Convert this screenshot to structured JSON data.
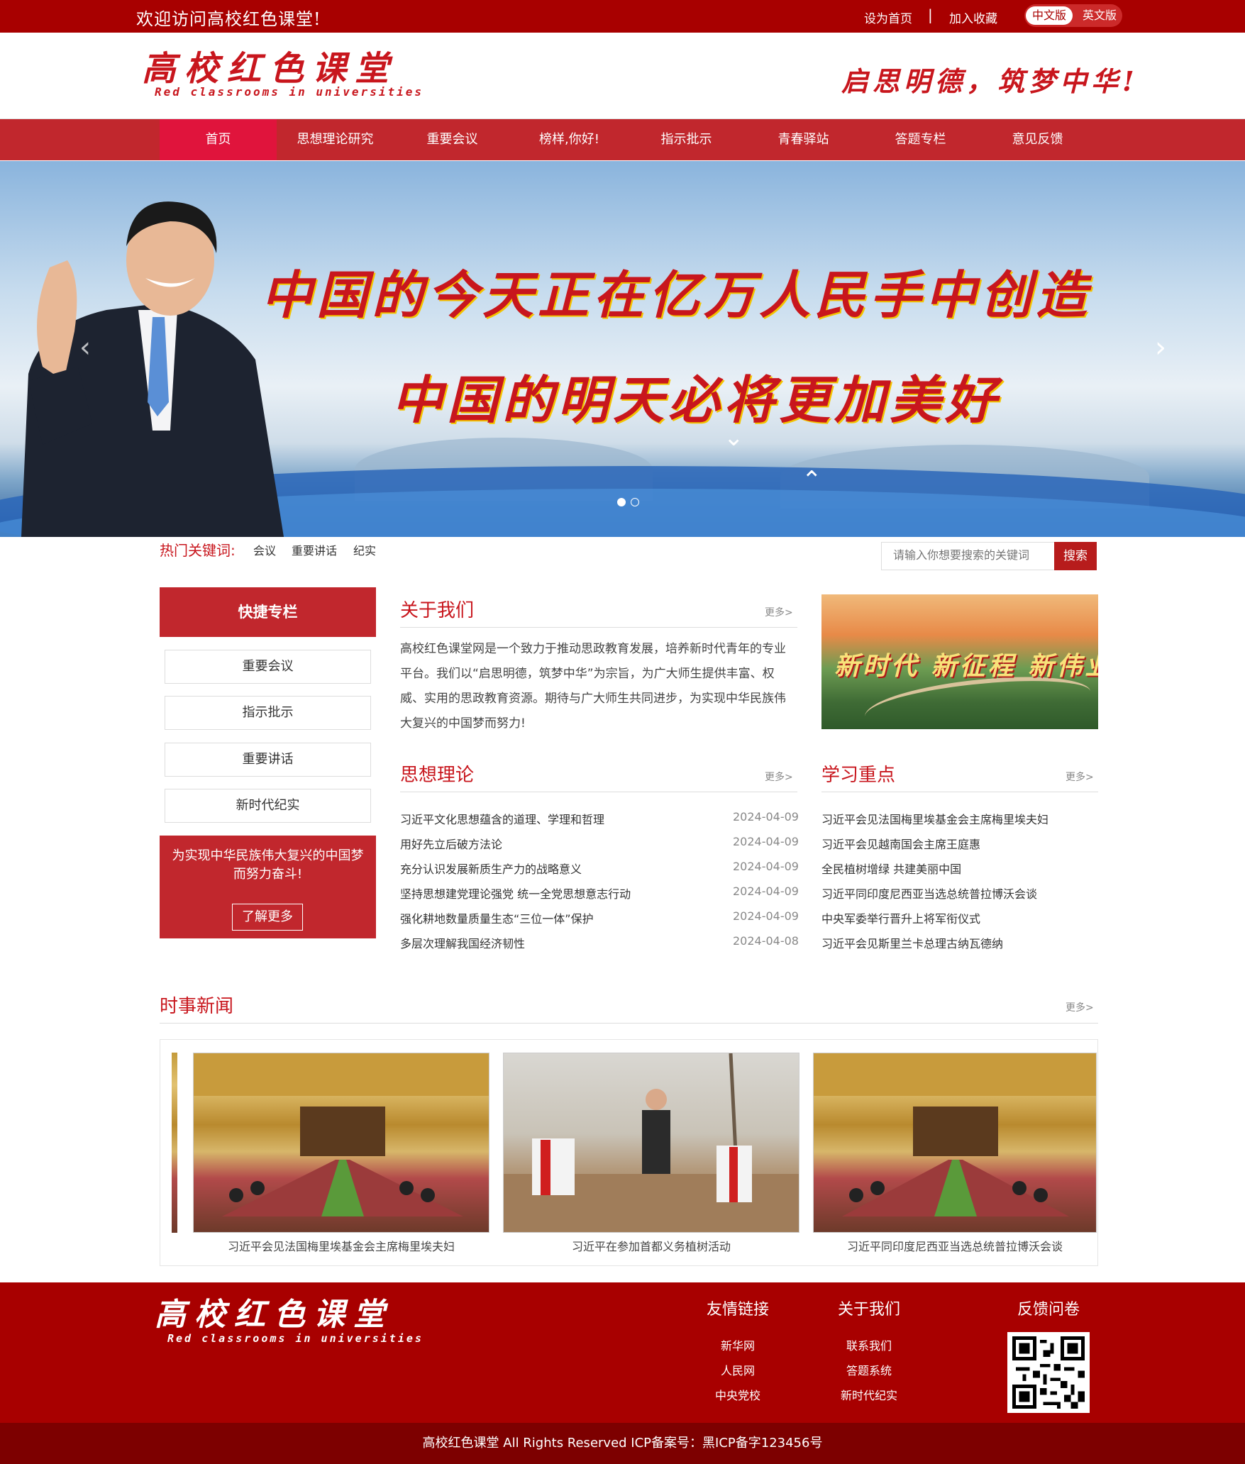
{
  "topbar": {
    "welcome": "欢迎访问高校红色课堂!",
    "set_home": "设为首页",
    "separator": "|",
    "bookmark": "加入收藏",
    "lang_zh": "中文版",
    "lang_en": "英文版"
  },
  "header": {
    "logo_cn": "高校红色课堂",
    "logo_en": "Red classrooms in universities",
    "slogan": "启思明德，筑梦中华!"
  },
  "nav": {
    "items": [
      "首页",
      "思想理论研究",
      "重要会议",
      "榜样,你好!",
      "指示批示",
      "青春驿站",
      "答题专栏",
      "意见反馈"
    ]
  },
  "banner": {
    "line1": "中国的今天正在亿万人民手中创造",
    "line2": "中国的明天必将更加美好",
    "prev_icon": "chevron-left-icon",
    "next_icon": "chevron-right-icon",
    "slide_count": 2,
    "active_slide": 1
  },
  "hot": {
    "label": "热门关键词:",
    "keywords": [
      "会议",
      "重要讲话",
      "纪实"
    ]
  },
  "search": {
    "placeholder": "请输入你想要搜索的关键词",
    "button": "搜索"
  },
  "quick": {
    "title": "快捷专栏",
    "items": [
      "重要会议",
      "指示批示",
      "重要讲话",
      "新时代纪实"
    ],
    "promo_text": "为实现中华民族伟大复兴的中国梦而努力奋斗!",
    "promo_button": "了解更多"
  },
  "about": {
    "title": "关于我们",
    "more": "更多>",
    "text": "高校红色课堂网是一个致力于推动思政教育发展，培养新时代青年的专业平台。我们以“启思明德，筑梦中华”为宗旨，为广大师生提供丰富、权威、实用的思政教育资源。期待与广大师生共同进步，为实现中华民族伟大复兴的中国梦而努力!"
  },
  "feature_image": {
    "text": "新时代 新征程 新伟业"
  },
  "theory": {
    "title": "思想理论",
    "more": "更多>",
    "items": [
      {
        "title": "习近平文化思想蕴含的道理、学理和哲理",
        "date": "2024-04-09"
      },
      {
        "title": "用好先立后破方法论",
        "date": "2024-04-09"
      },
      {
        "title": "充分认识发展新质生产力的战略意义",
        "date": "2024-04-09"
      },
      {
        "title": "坚持思想建党理论强党 统一全党思想意志行动",
        "date": "2024-04-09"
      },
      {
        "title": "强化耕地数量质量生态“三位一体”保护",
        "date": "2024-04-09"
      },
      {
        "title": "多层次理解我国经济韧性",
        "date": "2024-04-08"
      }
    ]
  },
  "study": {
    "title": "学习重点",
    "more": "更多>",
    "items": [
      "习近平会见法国梅里埃基金会主席梅里埃夫妇",
      "习近平会见越南国会主席王庭惠",
      "全民植树增绿 共建美丽中国",
      "习近平同印度尼西亚当选总统普拉博沃会谈",
      "中央军委举行晋升上将军衔仪式",
      "习近平会见斯里兰卡总理古纳瓦德纳"
    ]
  },
  "news": {
    "title": "时事新闻",
    "more": "更多>",
    "cards": [
      {
        "caption": "习近平会见法国梅里埃基金会主席梅里埃夫妇"
      },
      {
        "caption": "习近平在参加首都义务植树活动"
      },
      {
        "caption": "习近平同印度尼西亚当选总统普拉博沃会谈"
      }
    ]
  },
  "footer": {
    "logo_cn": "高校红色课堂",
    "logo_en": "Red classrooms in universities",
    "links_title": "友情链接",
    "links": [
      "新华网",
      "人民网",
      "中央党校"
    ],
    "about_title": "关于我们",
    "about_links": [
      "联系我们",
      "答题系统",
      "新时代纪实"
    ],
    "feedback_title": "反馈问卷",
    "copyright": "高校红色课堂 All Rights Reserved  ICP备案号：黑ICP备字123456号"
  },
  "colors": {
    "brand_red": "#c8161d",
    "dark_red": "#a80000",
    "nav_red": "#c1272d",
    "nav_active": "#e0143c"
  }
}
